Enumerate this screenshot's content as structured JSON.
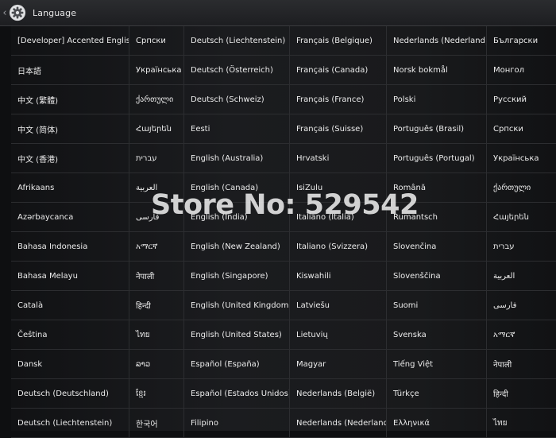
{
  "header": {
    "back_icon": "chevron-left-icon",
    "settings_icon": "gear-icon",
    "title": "Language"
  },
  "watermark": {
    "text": "Store No: 529542"
  },
  "languages": {
    "columns": [
      [
        "[Developer] Accented English",
        "日本語",
        "中文 (繁體)",
        "中文 (简体)",
        "中文 (香港)",
        "Afrikaans",
        "Azərbaycanca",
        "Bahasa Indonesia",
        "Bahasa Melayu",
        "Català",
        "Čeština",
        "Dansk",
        "Deutsch (Deutschland)",
        "Deutsch (Liechtenstein)"
      ],
      [
        "Српски",
        "Українська",
        "ქართული",
        "Հայերեն",
        "עברית",
        "العربية",
        "فارسی",
        "አማርኛ",
        "नेपाली",
        "हिन्दी",
        "ไทย",
        "ລາວ",
        "ខ្មែរ",
        "한국어"
      ],
      [
        "Deutsch (Liechtenstein)",
        "Deutsch (Österreich)",
        "Deutsch (Schweiz)",
        "Eesti",
        "English (Australia)",
        "English (Canada)",
        "English (India)",
        "English (New Zealand)",
        "English (Singapore)",
        "English (United Kingdom)",
        "English (United States)",
        "Español (España)",
        "Español (Estados Unidos)",
        "Filipino"
      ],
      [
        "Français (Belgique)",
        "Français (Canada)",
        "Français (France)",
        "Français (Suisse)",
        "Hrvatski",
        "IsiZulu",
        "Italiano (Italia)",
        "Italiano (Svizzera)",
        "Kiswahili",
        "Latviešu",
        "Lietuvių",
        "Magyar",
        "Nederlands (België)",
        "Nederlands (Nederland)"
      ],
      [
        "Nederlands (Nederland)",
        "Norsk bokmål",
        "Polski",
        "Português (Brasil)",
        "Português (Portugal)",
        "Română",
        "Rumantsch",
        "Slovenčina",
        "Slovenščina",
        "Suomi",
        "Svenska",
        "Tiếng Việt",
        "Türkçe",
        "Ελληνικά"
      ],
      [
        "Български",
        "Монгол",
        "Русский",
        "Српски",
        "Українська",
        "ქართული",
        "Հայերեն",
        "עברית",
        "العربية",
        "فارسی",
        "አማርኛ",
        "नेपाली",
        "हिन्दी",
        "ไทย"
      ]
    ]
  }
}
